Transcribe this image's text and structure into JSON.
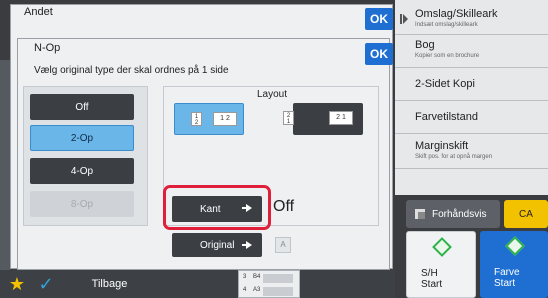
{
  "outer_dialog": {
    "title": "Andet",
    "ok_label": "OK"
  },
  "inner_dialog": {
    "title": "N-Op",
    "ok_label": "OK",
    "instruction": "Vælg original type der skal ordnes på 1 side",
    "options": [
      "Off",
      "2-Op",
      "4-Op",
      "8-Op"
    ],
    "selected_option": "2-Op",
    "disabled_option": "8-Op",
    "layout": {
      "label": "Layout",
      "choices": [
        {
          "pages": [
            "1",
            "2",
            "1",
            "2"
          ],
          "selected": true
        },
        {
          "pages": [
            "2",
            "1",
            "2",
            "1"
          ],
          "selected": false
        }
      ]
    },
    "border_button_label": "Kant",
    "border_value": "Off",
    "original_button_label": "Original",
    "original_icon_letter": "A"
  },
  "right_menu": {
    "items": [
      {
        "title": "Omslag/Skilleark",
        "sub": "Indsæt omslag/skilleark"
      },
      {
        "title": "Bog",
        "sub": "Kopier som en brochure"
      },
      {
        "title": "2-Sidet Kopi",
        "sub": ""
      },
      {
        "title": "Farvetilstand",
        "sub": ""
      },
      {
        "title": "Marginskift",
        "sub": "Skift pos. for at opnå margen"
      }
    ]
  },
  "preview_label": "Forhåndsvis",
  "ca_label": "CA",
  "start_bw": {
    "line1": "S/H",
    "line2": "Start"
  },
  "start_color": {
    "line1": "Farve",
    "line2": "Start"
  },
  "bottom": {
    "back_label": "Tilbage",
    "paper": [
      {
        "num": "3",
        "size": "B4"
      },
      {
        "num": "4",
        "size": "A3"
      }
    ]
  },
  "colors": {
    "accent": "#1f6fd2",
    "selected": "#6ab6e8",
    "highlight": "#e0203a",
    "ca": "#f2c200",
    "start_icon": "#2db34a"
  }
}
